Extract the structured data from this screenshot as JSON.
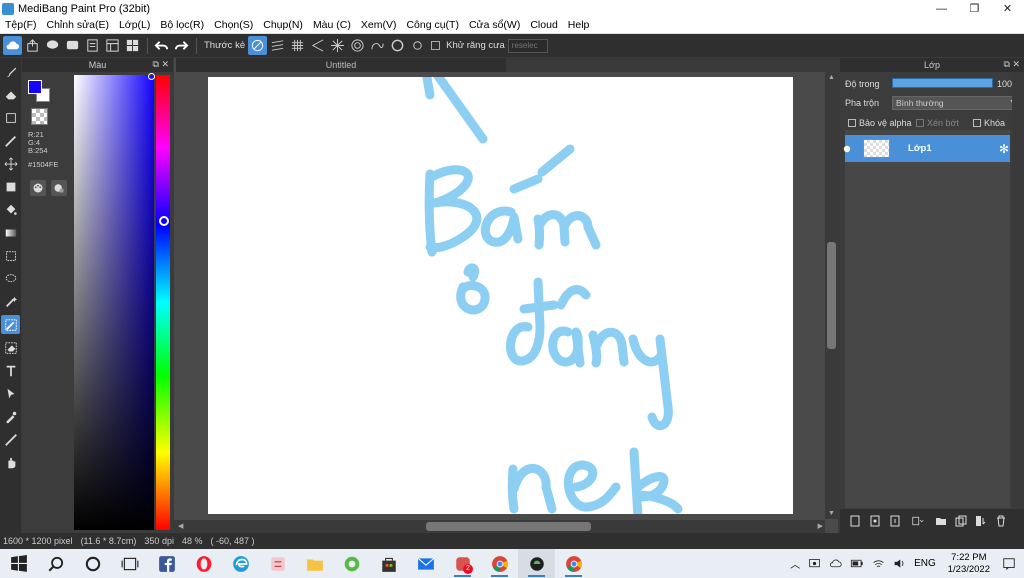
{
  "window": {
    "title": "MediBang Paint Pro (32bit)",
    "controls": [
      "—",
      "❐",
      "✕"
    ]
  },
  "menu": [
    "Tệp(F)",
    "Chỉnh sửa(E)",
    "Lớp(L)",
    "Bộ lọc(R)",
    "Chọn(S)",
    "Chụp(N)",
    "Màu (C)",
    "Xem(V)",
    "Công cụ(T)",
    "Cửa sổ(W)",
    "Cloud",
    "Help"
  ],
  "toolbar": {
    "ruler_label": "Thước kẻ",
    "antialias_label": "Khử răng cưa",
    "reselect_placeholder": "reselec"
  },
  "color_panel": {
    "title": "Màu",
    "r": "R:21",
    "g": "G:4",
    "b": "B:254",
    "hex": "#1504FE",
    "fg_color": "#1504fe",
    "bg_color": "#ffffff"
  },
  "document": {
    "tab_title": "Untitled"
  },
  "handwriting": {
    "color": "#8ccff2",
    "lines": [
      "Bấm",
      "ở đây",
      "nek"
    ]
  },
  "layer_panel": {
    "title": "Lớp",
    "opacity_label": "Độ trong",
    "opacity_value": "100 %",
    "blend_label": "Pha trộn",
    "blend_value": "Bình thường",
    "protect_alpha": "Bảo vệ alpha",
    "clipping": "Xén bớt",
    "lock": "Khóa",
    "layers": [
      {
        "name": "Lớp1"
      }
    ]
  },
  "status": {
    "size": "1600 * 1200 pixel",
    "size_cm": "(11.6 * 8.7cm)",
    "dpi": "350 dpi",
    "zoom": "48 %",
    "coords": "( -60, 487 )"
  },
  "taskbar": {
    "language": "ENG",
    "time": "7:22 PM",
    "date": "1/23/2022",
    "badge": "2"
  }
}
